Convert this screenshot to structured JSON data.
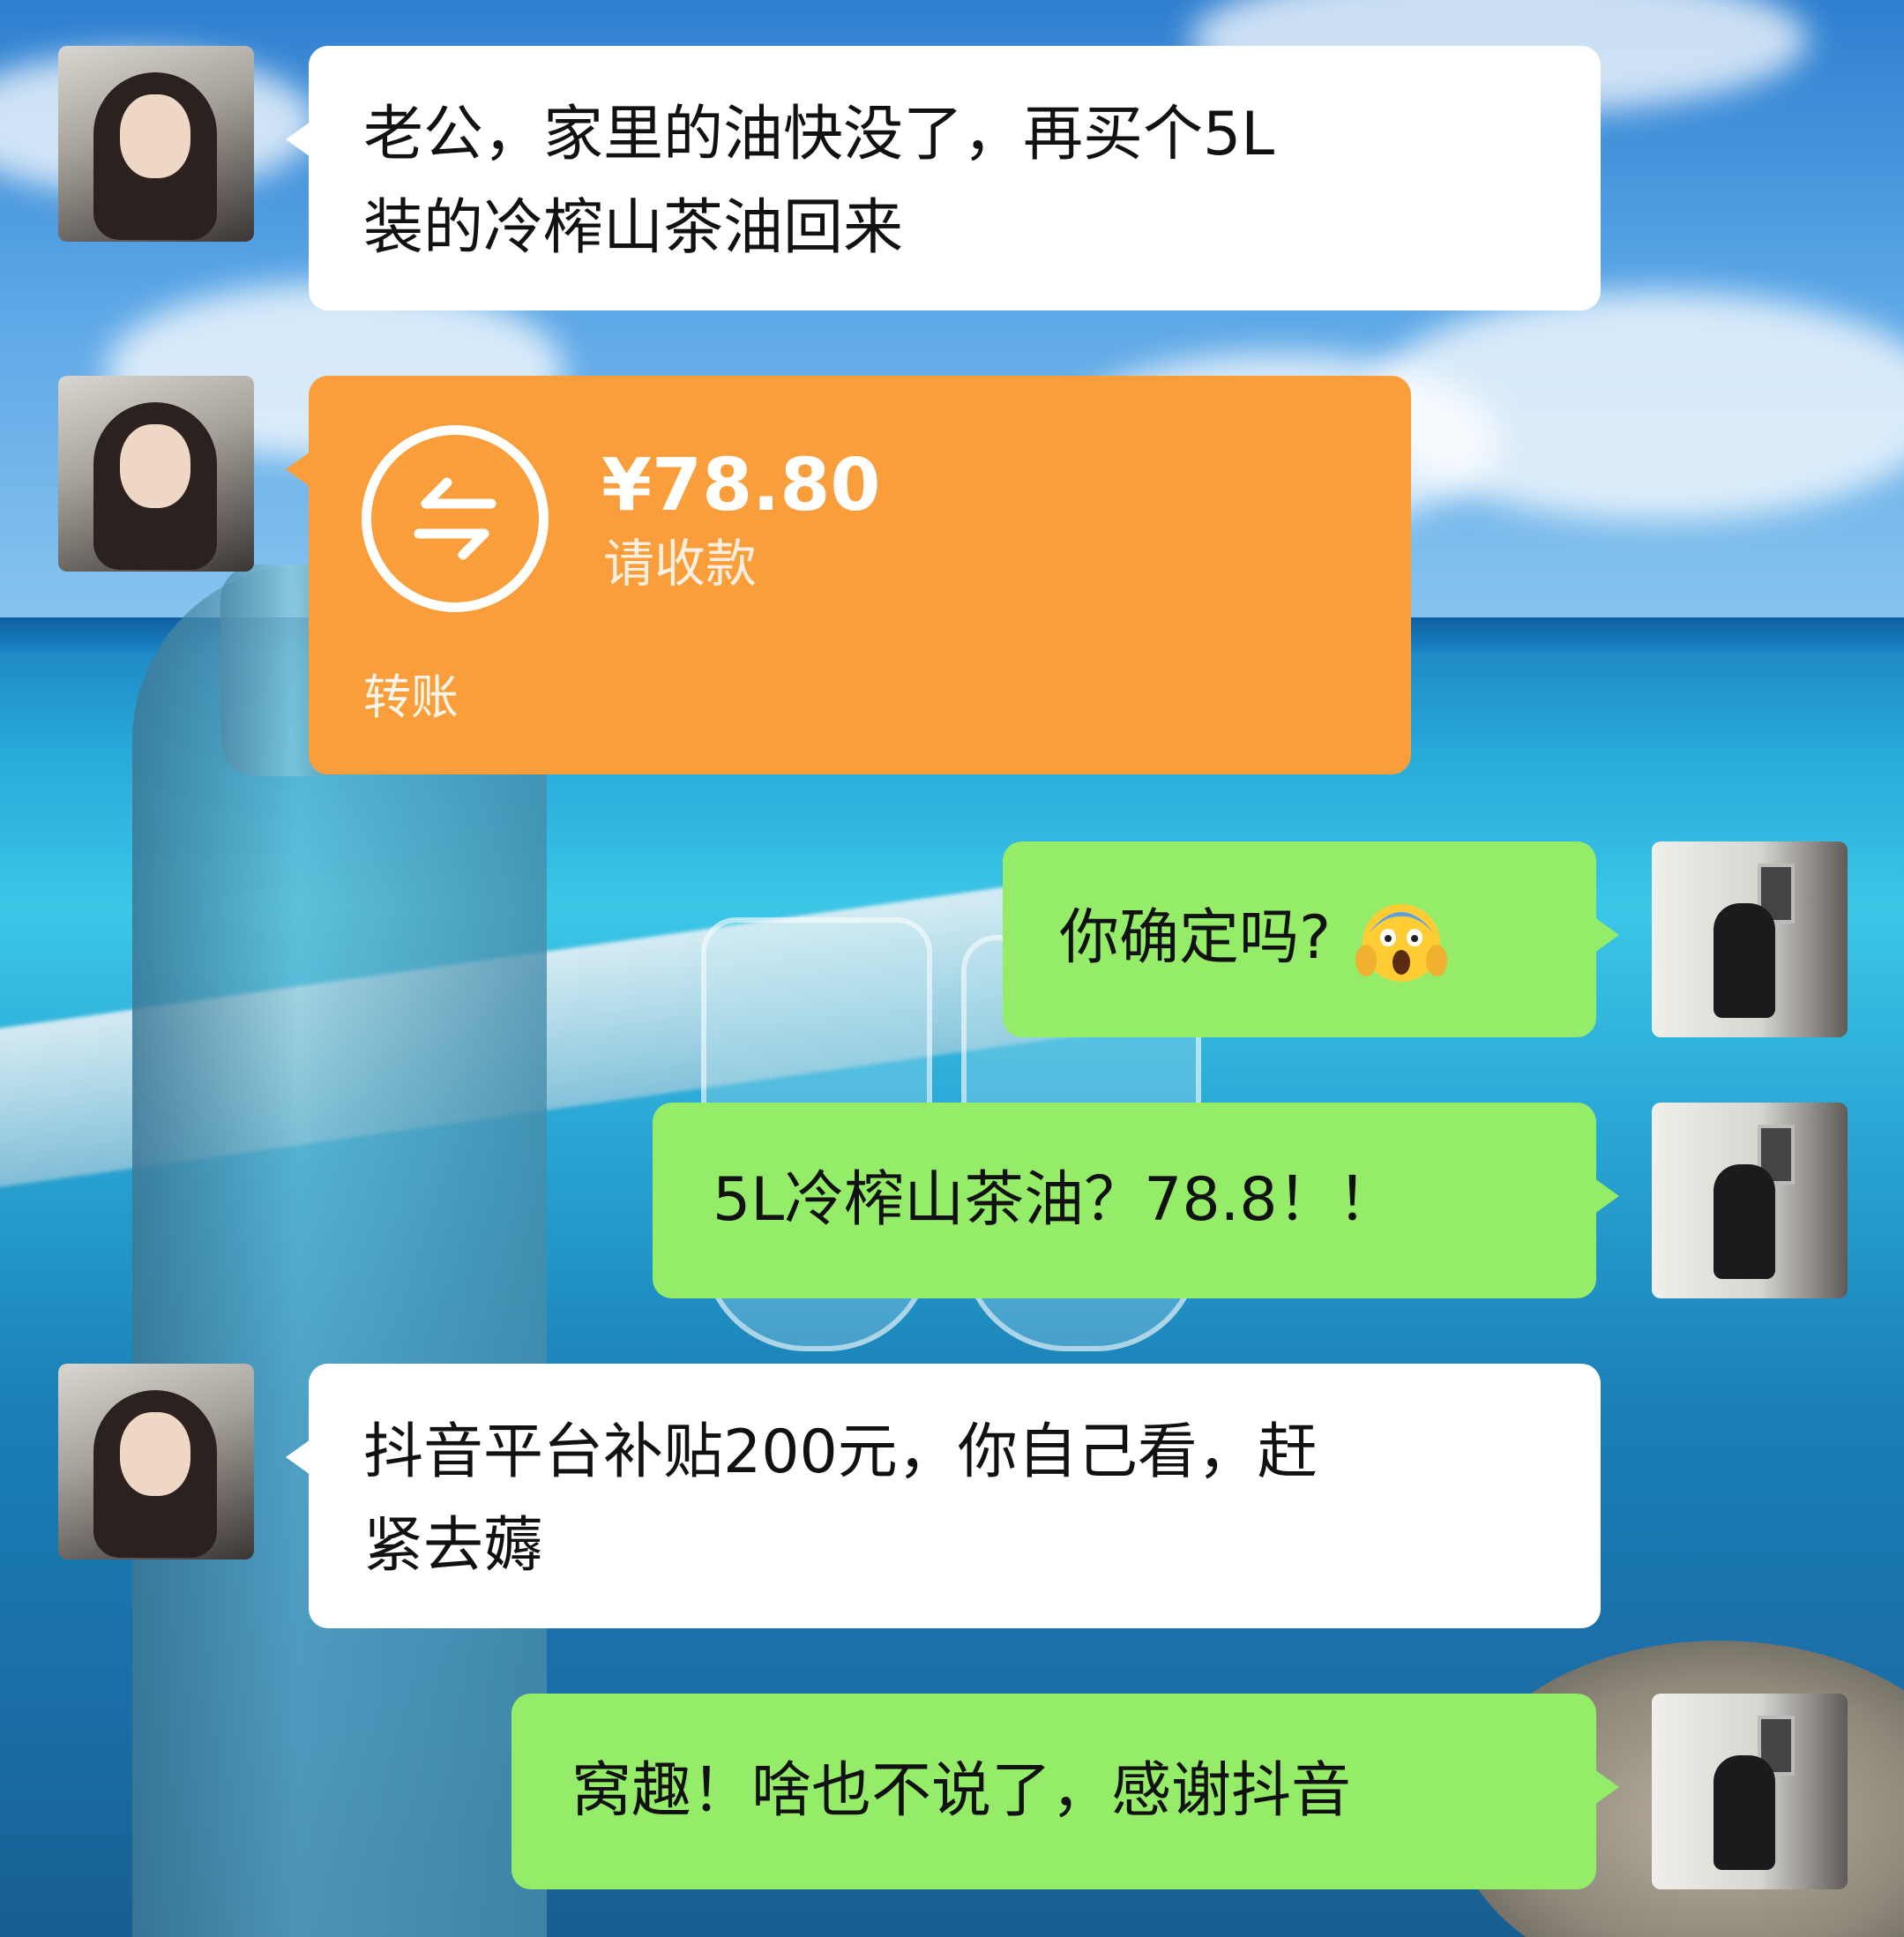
{
  "messages": [
    {
      "sender": "her",
      "type": "text",
      "text": "老公，家里的油快没了，再买个5L\n装的冷榨山茶油回来"
    },
    {
      "sender": "her",
      "type": "transfer",
      "amount": "¥78.80",
      "status": "请收款",
      "label": "转账"
    },
    {
      "sender": "me",
      "type": "text",
      "text": "你确定吗?",
      "emoji": "screaming-face-emoji"
    },
    {
      "sender": "me",
      "type": "text",
      "text": "5L冷榨山茶油？78.8！！"
    },
    {
      "sender": "her",
      "type": "text",
      "text": "抖音平台补贴200元，你自己看，赶\n紧去薅"
    },
    {
      "sender": "me",
      "type": "text",
      "text": "窝趣！啥也不说了，感谢抖音"
    }
  ],
  "colors": {
    "incoming_bubble": "#ffffff",
    "outgoing_bubble": "#95ec69",
    "transfer_bubble": "#fa9d3b"
  }
}
